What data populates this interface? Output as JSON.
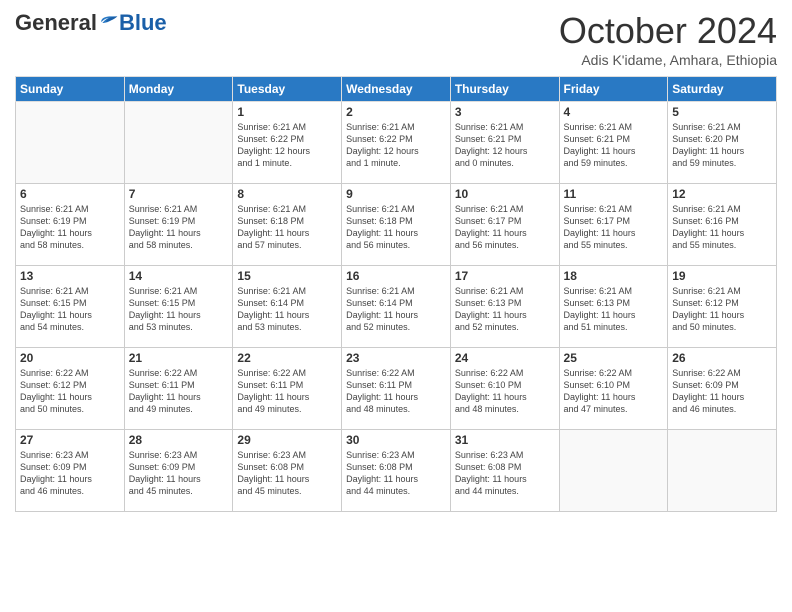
{
  "logo": {
    "general": "General",
    "blue": "Blue"
  },
  "header": {
    "month": "October 2024",
    "location": "Adis K'idame, Amhara, Ethiopia"
  },
  "weekdays": [
    "Sunday",
    "Monday",
    "Tuesday",
    "Wednesday",
    "Thursday",
    "Friday",
    "Saturday"
  ],
  "weeks": [
    [
      {
        "day": "",
        "info": ""
      },
      {
        "day": "",
        "info": ""
      },
      {
        "day": "1",
        "info": "Sunrise: 6:21 AM\nSunset: 6:22 PM\nDaylight: 12 hours\nand 1 minute."
      },
      {
        "day": "2",
        "info": "Sunrise: 6:21 AM\nSunset: 6:22 PM\nDaylight: 12 hours\nand 1 minute."
      },
      {
        "day": "3",
        "info": "Sunrise: 6:21 AM\nSunset: 6:21 PM\nDaylight: 12 hours\nand 0 minutes."
      },
      {
        "day": "4",
        "info": "Sunrise: 6:21 AM\nSunset: 6:21 PM\nDaylight: 11 hours\nand 59 minutes."
      },
      {
        "day": "5",
        "info": "Sunrise: 6:21 AM\nSunset: 6:20 PM\nDaylight: 11 hours\nand 59 minutes."
      }
    ],
    [
      {
        "day": "6",
        "info": "Sunrise: 6:21 AM\nSunset: 6:19 PM\nDaylight: 11 hours\nand 58 minutes."
      },
      {
        "day": "7",
        "info": "Sunrise: 6:21 AM\nSunset: 6:19 PM\nDaylight: 11 hours\nand 58 minutes."
      },
      {
        "day": "8",
        "info": "Sunrise: 6:21 AM\nSunset: 6:18 PM\nDaylight: 11 hours\nand 57 minutes."
      },
      {
        "day": "9",
        "info": "Sunrise: 6:21 AM\nSunset: 6:18 PM\nDaylight: 11 hours\nand 56 minutes."
      },
      {
        "day": "10",
        "info": "Sunrise: 6:21 AM\nSunset: 6:17 PM\nDaylight: 11 hours\nand 56 minutes."
      },
      {
        "day": "11",
        "info": "Sunrise: 6:21 AM\nSunset: 6:17 PM\nDaylight: 11 hours\nand 55 minutes."
      },
      {
        "day": "12",
        "info": "Sunrise: 6:21 AM\nSunset: 6:16 PM\nDaylight: 11 hours\nand 55 minutes."
      }
    ],
    [
      {
        "day": "13",
        "info": "Sunrise: 6:21 AM\nSunset: 6:15 PM\nDaylight: 11 hours\nand 54 minutes."
      },
      {
        "day": "14",
        "info": "Sunrise: 6:21 AM\nSunset: 6:15 PM\nDaylight: 11 hours\nand 53 minutes."
      },
      {
        "day": "15",
        "info": "Sunrise: 6:21 AM\nSunset: 6:14 PM\nDaylight: 11 hours\nand 53 minutes."
      },
      {
        "day": "16",
        "info": "Sunrise: 6:21 AM\nSunset: 6:14 PM\nDaylight: 11 hours\nand 52 minutes."
      },
      {
        "day": "17",
        "info": "Sunrise: 6:21 AM\nSunset: 6:13 PM\nDaylight: 11 hours\nand 52 minutes."
      },
      {
        "day": "18",
        "info": "Sunrise: 6:21 AM\nSunset: 6:13 PM\nDaylight: 11 hours\nand 51 minutes."
      },
      {
        "day": "19",
        "info": "Sunrise: 6:21 AM\nSunset: 6:12 PM\nDaylight: 11 hours\nand 50 minutes."
      }
    ],
    [
      {
        "day": "20",
        "info": "Sunrise: 6:22 AM\nSunset: 6:12 PM\nDaylight: 11 hours\nand 50 minutes."
      },
      {
        "day": "21",
        "info": "Sunrise: 6:22 AM\nSunset: 6:11 PM\nDaylight: 11 hours\nand 49 minutes."
      },
      {
        "day": "22",
        "info": "Sunrise: 6:22 AM\nSunset: 6:11 PM\nDaylight: 11 hours\nand 49 minutes."
      },
      {
        "day": "23",
        "info": "Sunrise: 6:22 AM\nSunset: 6:11 PM\nDaylight: 11 hours\nand 48 minutes."
      },
      {
        "day": "24",
        "info": "Sunrise: 6:22 AM\nSunset: 6:10 PM\nDaylight: 11 hours\nand 48 minutes."
      },
      {
        "day": "25",
        "info": "Sunrise: 6:22 AM\nSunset: 6:10 PM\nDaylight: 11 hours\nand 47 minutes."
      },
      {
        "day": "26",
        "info": "Sunrise: 6:22 AM\nSunset: 6:09 PM\nDaylight: 11 hours\nand 46 minutes."
      }
    ],
    [
      {
        "day": "27",
        "info": "Sunrise: 6:23 AM\nSunset: 6:09 PM\nDaylight: 11 hours\nand 46 minutes."
      },
      {
        "day": "28",
        "info": "Sunrise: 6:23 AM\nSunset: 6:09 PM\nDaylight: 11 hours\nand 45 minutes."
      },
      {
        "day": "29",
        "info": "Sunrise: 6:23 AM\nSunset: 6:08 PM\nDaylight: 11 hours\nand 45 minutes."
      },
      {
        "day": "30",
        "info": "Sunrise: 6:23 AM\nSunset: 6:08 PM\nDaylight: 11 hours\nand 44 minutes."
      },
      {
        "day": "31",
        "info": "Sunrise: 6:23 AM\nSunset: 6:08 PM\nDaylight: 11 hours\nand 44 minutes."
      },
      {
        "day": "",
        "info": ""
      },
      {
        "day": "",
        "info": ""
      }
    ]
  ]
}
